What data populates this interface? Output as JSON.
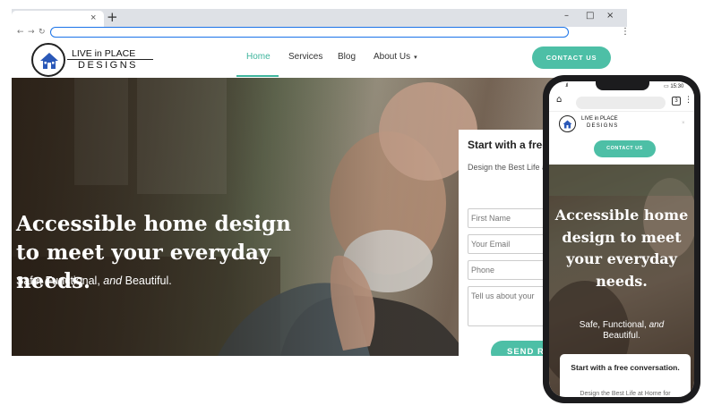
{
  "colors": {
    "accent": "#4dbfa6",
    "nav_active": "#3fb59d",
    "url_focus": "#1a73e8"
  },
  "browser": {
    "new_tab_icon": "+",
    "tab_close_icon": "×",
    "window_controls": [
      "–",
      "□",
      "×"
    ],
    "nav_icons": [
      "←",
      "→",
      "↻"
    ],
    "menu_icon": "⋮"
  },
  "site": {
    "logo": {
      "line1": "LIVE in PLACE",
      "line2": "DESIGNS"
    },
    "nav": [
      {
        "label": "Home",
        "active": true
      },
      {
        "label": "Services"
      },
      {
        "label": "Blog"
      },
      {
        "label": "About Us",
        "dropdown_icon": "▾"
      }
    ],
    "contact_button": "CONTACT US",
    "hero": {
      "title": "Accessible home design to meet your everyday needs.",
      "subtitle_pre": "Safe, Functional, ",
      "subtitle_em": "and",
      "subtitle_post": " Beautiful."
    },
    "form": {
      "title": "Start with a free",
      "description": "Design the Best Life and your loved ones",
      "first_name_placeholder": "First Name",
      "email_placeholder": "Your Email",
      "phone_placeholder": "Phone",
      "message_placeholder": "Tell us about your",
      "submit_label": "SEND RE"
    }
  },
  "mobile": {
    "status": {
      "signal": ".ıll",
      "battery_time": "▭ 15:30"
    },
    "home_icon": "⌂",
    "tab_count": "3",
    "menu_icon": "⋮",
    "logo": {
      "line1": "LIVE in PLACE",
      "line2": "DESIGNS"
    },
    "contact_button": "CONTACT US",
    "hero": {
      "title": "Accessible home design to meet your everyday needs.",
      "subtitle_pre": "Safe, Functional, ",
      "subtitle_em": "and",
      "subtitle_post": " Beautiful."
    },
    "card": {
      "title": "Start with a free conversation.",
      "description": "Design the Best Life at Home for"
    }
  }
}
